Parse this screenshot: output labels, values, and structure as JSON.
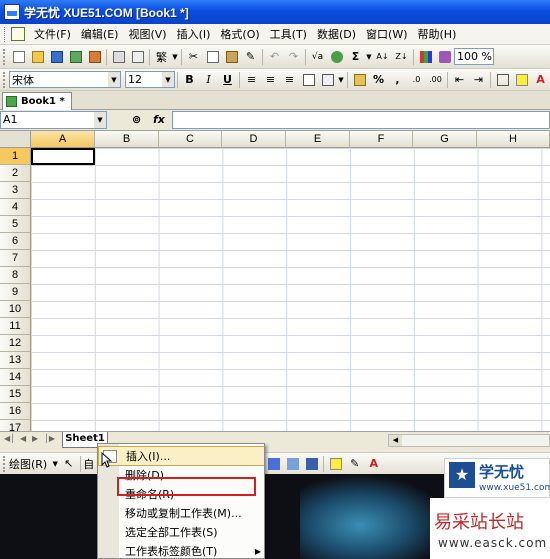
{
  "window": {
    "title": "学无忧 XUE51.COM [Book1 *]"
  },
  "menubar": {
    "items": [
      "文件(F)",
      "编辑(E)",
      "视图(V)",
      "插入(I)",
      "格式(O)",
      "工具(T)",
      "数据(D)",
      "窗口(W)",
      "帮助(H)"
    ]
  },
  "standard_toolbar": {
    "zoom": "100 %"
  },
  "format_toolbar": {
    "font_name": "宋体",
    "font_size": "12",
    "bold": "B",
    "italic": "I",
    "underline": "U",
    "percent": "%"
  },
  "document": {
    "tab_label": "Book1 *"
  },
  "formula_bar": {
    "cell_ref": "A1",
    "fx_label": "fx",
    "value": ""
  },
  "sheet": {
    "columns": [
      "A",
      "B",
      "C",
      "D",
      "E",
      "F",
      "G",
      "H"
    ],
    "rows": [
      "1",
      "2",
      "3",
      "4",
      "5",
      "6",
      "7",
      "8",
      "9",
      "10",
      "11",
      "12",
      "13",
      "14",
      "15",
      "16",
      "17"
    ],
    "active_cell": "A1",
    "tabs": [
      "Sheet1"
    ]
  },
  "drawing_toolbar": {
    "draw_label": "绘图(R)",
    "autoshape_label": "自"
  },
  "context_menu": {
    "items": [
      {
        "label": "插入(I)...",
        "has_icon": true
      },
      {
        "label": "删除(D)"
      },
      {
        "label": "重命名(R)"
      },
      {
        "label": "移动或复制工作表(M)...",
        "highlighted_border": true
      },
      {
        "label": "选定全部工作表(S)"
      },
      {
        "label": "工作表标签颜色(T)",
        "submenu": true
      }
    ]
  },
  "watermarks": {
    "xue51_name": "学无忧",
    "xue51_url": "www.xue51.com",
    "easck_name": "易采站长站",
    "easck_url": "www.easck.com"
  },
  "colors": {
    "title_blue": "#0a4ee0",
    "selected_header": "#f5c860",
    "menu_highlight": "#fbf0c5",
    "annotation_red": "#d21f1f"
  }
}
